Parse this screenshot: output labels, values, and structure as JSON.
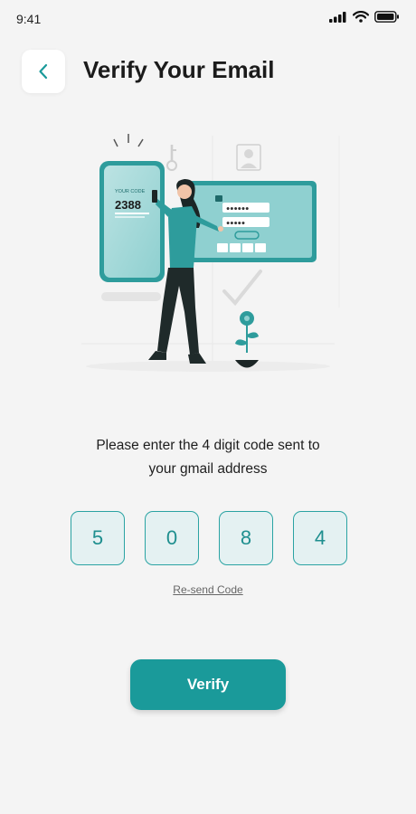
{
  "status_bar": {
    "time": "9:41"
  },
  "header": {
    "title": "Verify Your Email",
    "back_icon": "chevron-left-icon"
  },
  "illustration": {
    "phone_label": "YOUR CODE",
    "phone_code": "2388"
  },
  "instruction": {
    "line1": "Please enter the 4 digit code sent to",
    "line2": "your gmail address"
  },
  "code": {
    "digits": [
      "5",
      "0",
      "8",
      "4"
    ]
  },
  "resend_label": "Re-send Code",
  "verify_label": "Verify",
  "colors": {
    "accent": "#1a9a9a",
    "box_bg": "#e4f1f2",
    "box_border": "#2aa3a3",
    "background": "#f4f4f4"
  }
}
